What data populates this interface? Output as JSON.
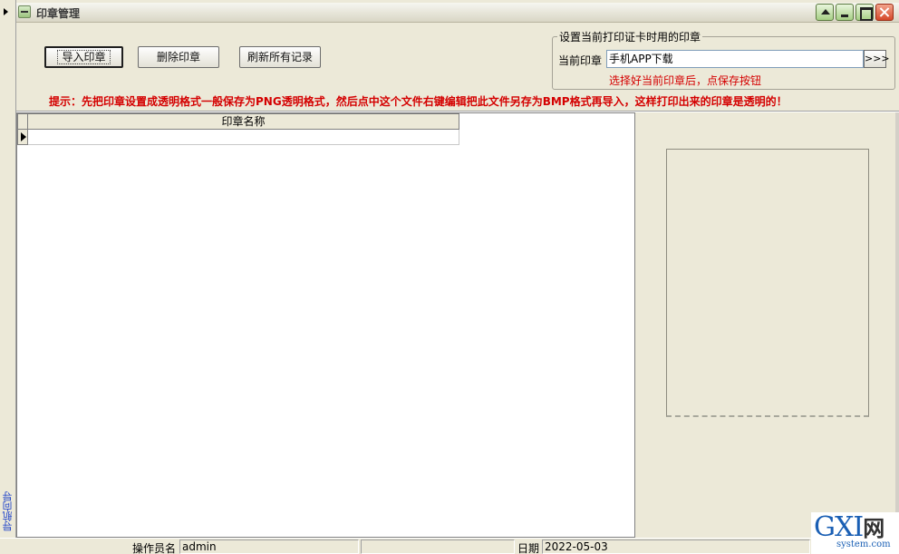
{
  "window": {
    "title": "印章管理"
  },
  "toolbar": {
    "import_label": "导入印章",
    "delete_label": "删除印章",
    "refresh_label": "刷新所有记录"
  },
  "current_seal_group": {
    "title": "设置当前打印证卡时用的印章",
    "label": "当前印章",
    "value": "手机APP下载",
    "pick_button": ">>>",
    "hint": "选择好当前印章后，点保存按钮"
  },
  "tip": "提示：先把印章设置成透明格式一般保存为PNG透明格式，然后点中这个文件右键编辑把此文件另存为BMP格式再导入，这样打印出来的印章是透明的！",
  "grid": {
    "columns": [
      "印章名称"
    ],
    "rows": [
      [
        ""
      ]
    ]
  },
  "nav": {
    "label": "导航向导"
  },
  "statusbar": {
    "operator_label": "操作员名",
    "operator_value": "admin",
    "date_label": "日期",
    "date_value": "2022-05-03"
  },
  "watermark": {
    "main": "GXI",
    "cn": "网",
    "sub": "system.com"
  },
  "colors": {
    "tip_red": "#d40000",
    "nav_blue": "#1a3fc9",
    "bg": "#ece9d8"
  }
}
